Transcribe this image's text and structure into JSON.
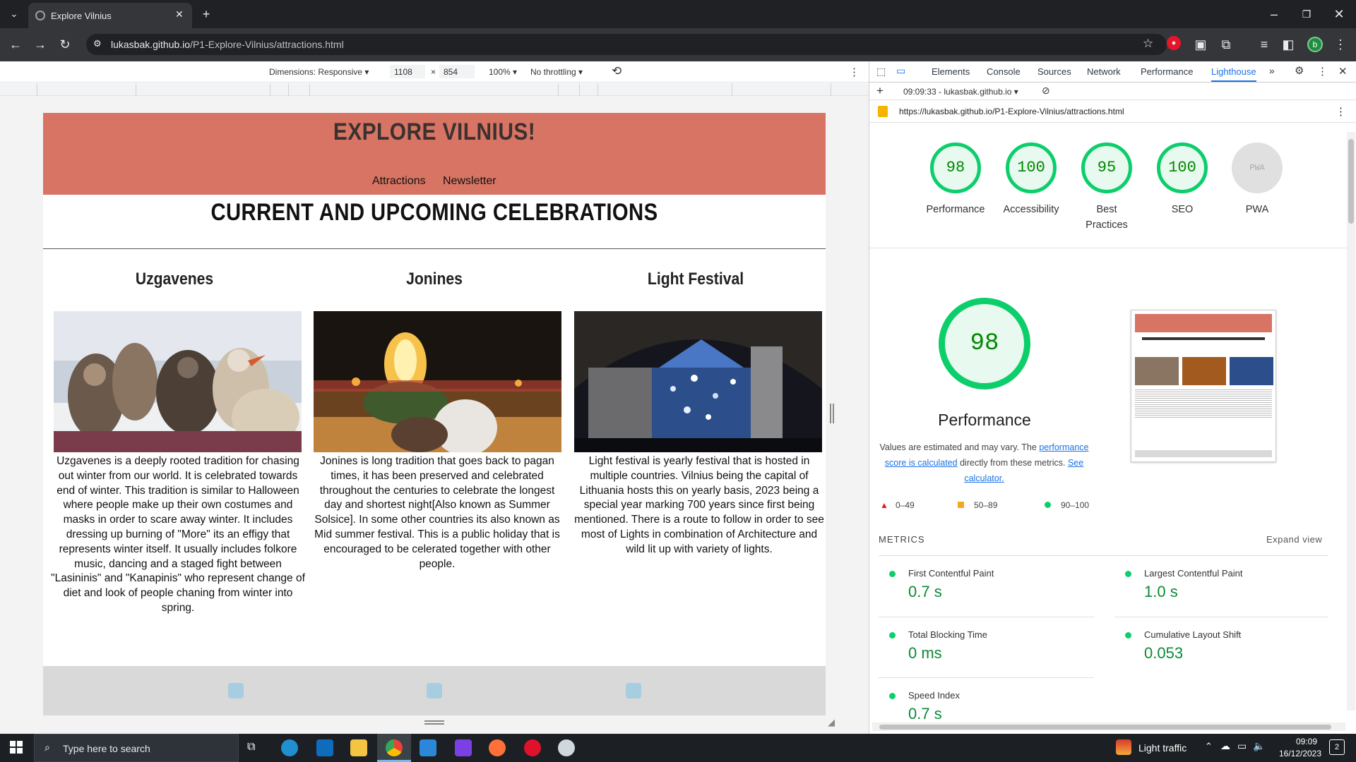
{
  "browser": {
    "tab_title": "Explore Vilnius",
    "url_host": "lukasbak.github.io",
    "url_path": "/P1-Explore-Vilnius/attractions.html",
    "profile_initial": "b"
  },
  "device_toolbar": {
    "dimensions_label": "Dimensions: Responsive",
    "width": "1108",
    "times": "×",
    "height": "854",
    "zoom": "100%",
    "throttling": "No throttling"
  },
  "site": {
    "title": "EXPLORE VILNIUS!",
    "nav": [
      "Attractions",
      "Newsletter"
    ],
    "heading": "CURRENT AND UPCOMING CELEBRATIONS",
    "columns": [
      {
        "title": "Uzgavenes",
        "text": "Uzgavenes is a deeply rooted tradition for chasing out winter from our world. It is celebrated towards end of winter. This tradition is similar to Halloween where people make up their own costumes and masks in order to scare away winter. It includes dressing up burning of \"More\" its an effigy that represents winter itself. It usually includes folkore music, dancing and a staged fight between \"Lasininis\" and \"Kanapinis\" who represent change of diet and look of people chaning from winter into spring."
      },
      {
        "title": "Jonines",
        "text": "Jonines is long tradition that goes back to pagan times, it has been preserved and celebrated throughout the centuries to celebrate the longest day and shortest night[Also known as Summer Solsice]. In some other countries its also known as Mid summer festival. This is a public holiday that is encouraged to be celerated together with other people."
      },
      {
        "title": "Light Festival",
        "text": "Light festival is yearly festival that is hosted in multiple countries. Vilnius being the capital of Lithuania hosts this on yearly basis, 2023 being a special year marking 700 years since first being mentioned. There is a route to follow in order to see most of Lights in combination of Architecture and wild lit up with variety of lights."
      }
    ],
    "colors": {
      "header_bg": "#d87463",
      "footer_bg": "#d9d9d9",
      "social_icon": "#a7cde0"
    }
  },
  "devtools": {
    "tabs": [
      "Elements",
      "Console",
      "Sources",
      "Network",
      "Performance",
      "Lighthouse"
    ],
    "active_tab": "Lighthouse",
    "report_label": "09:09:33 - lukasbak.github.io",
    "url": "https://lukasbak.github.io/P1-Explore-Vilnius/attractions.html",
    "scores": [
      {
        "value": "98",
        "label": "Performance"
      },
      {
        "value": "100",
        "label": "Accessibility"
      },
      {
        "value": "95",
        "label": "Best Practices"
      },
      {
        "value": "100",
        "label": "SEO"
      },
      {
        "value": "PWA",
        "label": "PWA"
      }
    ],
    "big_score": "98",
    "big_label": "Performance",
    "note_pre": "Values are estimated and may vary. The",
    "note_link1": "performance score is calculated",
    "note_mid": "directly from these metrics.",
    "note_link2": "See calculator.",
    "legend": [
      "0–49",
      "50–89",
      "90–100"
    ],
    "metrics_title": "METRICS",
    "expand_view": "Expand view",
    "metrics": [
      {
        "label": "First Contentful Paint",
        "value": "0.7 s"
      },
      {
        "label": "Largest Contentful Paint",
        "value": "1.0 s"
      },
      {
        "label": "Total Blocking Time",
        "value": "0 ms"
      },
      {
        "label": "Cumulative Layout Shift",
        "value": "0.053"
      },
      {
        "label": "Speed Index",
        "value": "0.7 s"
      }
    ]
  },
  "taskbar": {
    "search_placeholder": "Type here to search",
    "weather": "Light traffic",
    "time": "09:09",
    "date": "16/12/2023",
    "notification_count": "2"
  }
}
